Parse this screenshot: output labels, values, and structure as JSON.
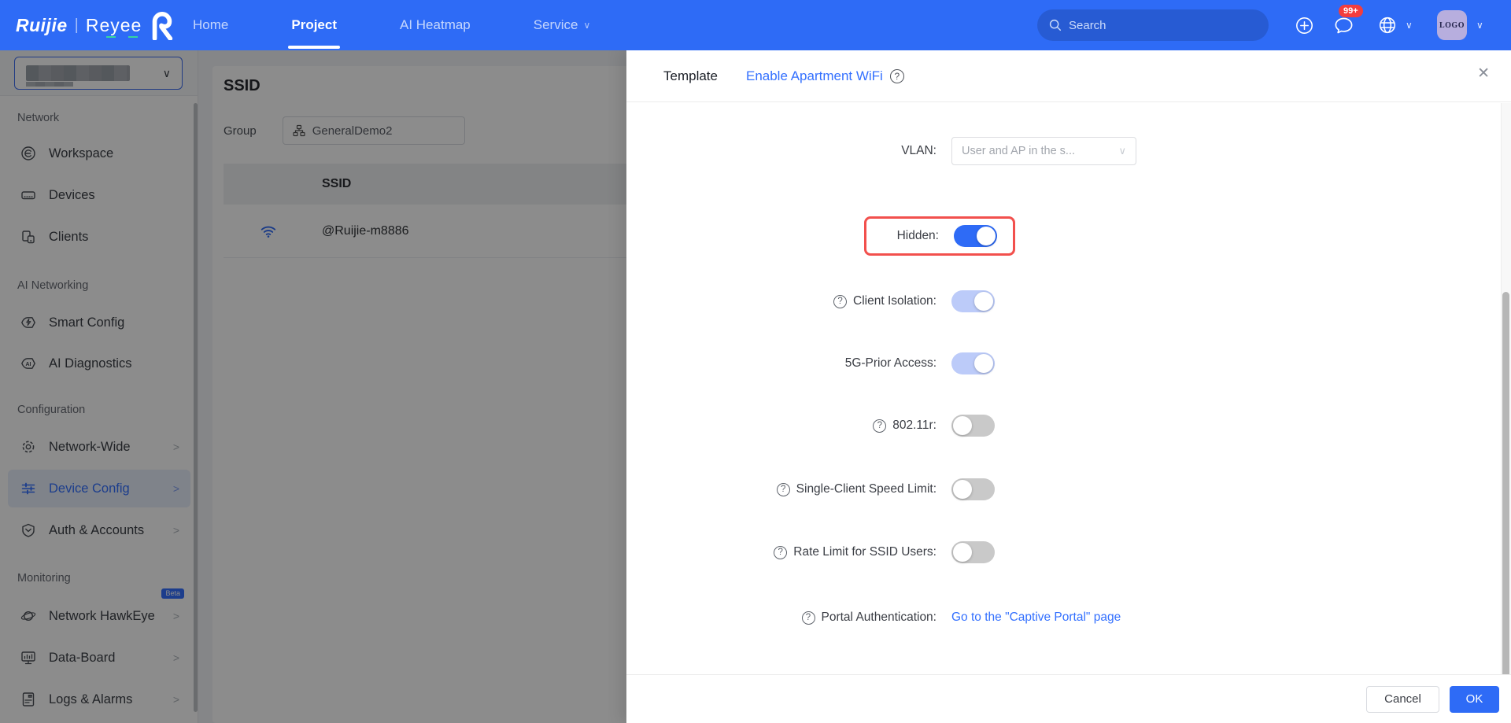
{
  "nav": {
    "logo": {
      "brand": "Ruijie",
      "separator": "|",
      "sub_brand": "Reyee"
    },
    "items": [
      {
        "label": "Home",
        "active": false
      },
      {
        "label": "Project",
        "active": true
      },
      {
        "label": "AI Heatmap",
        "active": false
      },
      {
        "label": "Service",
        "active": false
      }
    ],
    "search": {
      "placeholder": "Search"
    },
    "notification_badge": "99+",
    "avatar_label": "LOGO"
  },
  "sidebar": {
    "sections": [
      {
        "label": "Network",
        "items": [
          {
            "label": "Workspace"
          },
          {
            "label": "Devices"
          },
          {
            "label": "Clients"
          }
        ]
      },
      {
        "label": "AI Networking",
        "items": [
          {
            "label": "Smart Config"
          },
          {
            "label": "AI Diagnostics"
          }
        ]
      },
      {
        "label": "Configuration",
        "items": [
          {
            "label": "Network-Wide"
          },
          {
            "label": "Device Config",
            "active": true
          },
          {
            "label": "Auth & Accounts"
          }
        ]
      },
      {
        "label": "Monitoring",
        "items": [
          {
            "label": "Network HawkEye",
            "badge": "Beta"
          },
          {
            "label": "Data-Board"
          },
          {
            "label": "Logs & Alarms"
          }
        ]
      }
    ]
  },
  "content": {
    "title": "SSID",
    "group_label": "Group",
    "group_value": "GeneralDemo2",
    "table": {
      "columns": [
        "SSID"
      ],
      "rows": [
        [
          "@Ruijie-m8886"
        ]
      ]
    }
  },
  "drawer": {
    "tabs": [
      {
        "label": "Template",
        "active": false
      },
      {
        "label": "Enable Apartment WiFi",
        "active": true
      }
    ],
    "form": {
      "vlan": {
        "label": "VLAN:",
        "value": "User and AP in the s..."
      },
      "hidden": {
        "label": "Hidden:",
        "state": "on"
      },
      "client_isolation": {
        "label": "Client Isolation:",
        "state": "on-dim"
      },
      "five_g_prior": {
        "label": "5G-Prior Access:",
        "state": "on-dim"
      },
      "dot11r": {
        "label": "802.11r:",
        "state": "off"
      },
      "single_client_limit": {
        "label": "Single-Client Speed Limit:",
        "state": "off"
      },
      "rate_limit_ssid": {
        "label": "Rate Limit for SSID Users:",
        "state": "off"
      },
      "portal": {
        "label": "Portal Authentication:",
        "link_text": "Go to the \"Captive Portal\" page"
      }
    },
    "footer": {
      "cancel": "Cancel",
      "ok": "OK"
    }
  },
  "icons": {
    "help": "?",
    "chevron_down": "∨",
    "chevron_right": ">",
    "close": "✕"
  },
  "colors": {
    "nav_blue": "#2e6bf6",
    "link_blue": "#3370ff",
    "toggle_on": "#2e6bf6",
    "toggle_on_dim": "#bccbf9",
    "toggle_off": "#c9c9c9",
    "highlight_red": "#f2504d",
    "badge_red": "#f43d3d",
    "active_item_bg": "#e8effc"
  }
}
